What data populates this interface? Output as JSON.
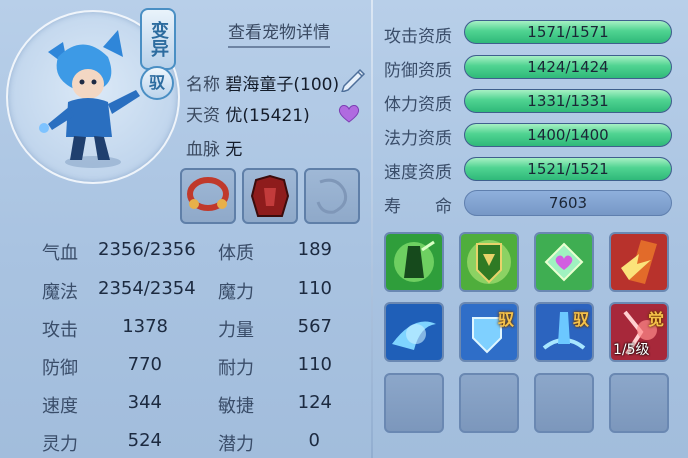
{
  "header": {
    "view_details": "查看宠物详情",
    "change_badge": "变异",
    "ride_badge": "驭"
  },
  "info": {
    "name_label": "名称",
    "name_value": "碧海童子(100)",
    "talent_label": "天资",
    "talent_value": "优(15421)",
    "bloodline_label": "血脉",
    "bloodline_value": "无"
  },
  "stats": [
    {
      "label": "气血",
      "value": "2356/2356"
    },
    {
      "label": "魔法",
      "value": "2354/2354"
    },
    {
      "label": "攻击",
      "value": "1378"
    },
    {
      "label": "防御",
      "value": "770"
    },
    {
      "label": "速度",
      "value": "344"
    },
    {
      "label": "灵力",
      "value": "524"
    }
  ],
  "attributes": [
    {
      "label": "体质",
      "value": "189"
    },
    {
      "label": "魔力",
      "value": "110"
    },
    {
      "label": "力量",
      "value": "567"
    },
    {
      "label": "耐力",
      "value": "110"
    },
    {
      "label": "敏捷",
      "value": "124"
    },
    {
      "label": "潜力",
      "value": "0"
    }
  ],
  "aptitudes": [
    {
      "label": "攻击资质",
      "value": "1571/1571",
      "fraction": 1.0
    },
    {
      "label": "防御资质",
      "value": "1424/1424",
      "fraction": 1.0
    },
    {
      "label": "体力资质",
      "value": "1331/1331",
      "fraction": 1.0
    },
    {
      "label": "法力资质",
      "value": "1400/1400",
      "fraction": 1.0
    },
    {
      "label": "速度资质",
      "value": "1521/1521",
      "fraction": 1.0
    }
  ],
  "life": {
    "label": "寿　　命",
    "value": "7603"
  },
  "skills": {
    "row2_tag_2": "驭",
    "row2_tag_3": "驭",
    "row2_tag_4": "觉",
    "row2_level_4": "1/5级"
  },
  "colors": {
    "bar_fill": "#3fc886",
    "accent_blue": "#4a8fc4",
    "heart": "#b06be0"
  }
}
